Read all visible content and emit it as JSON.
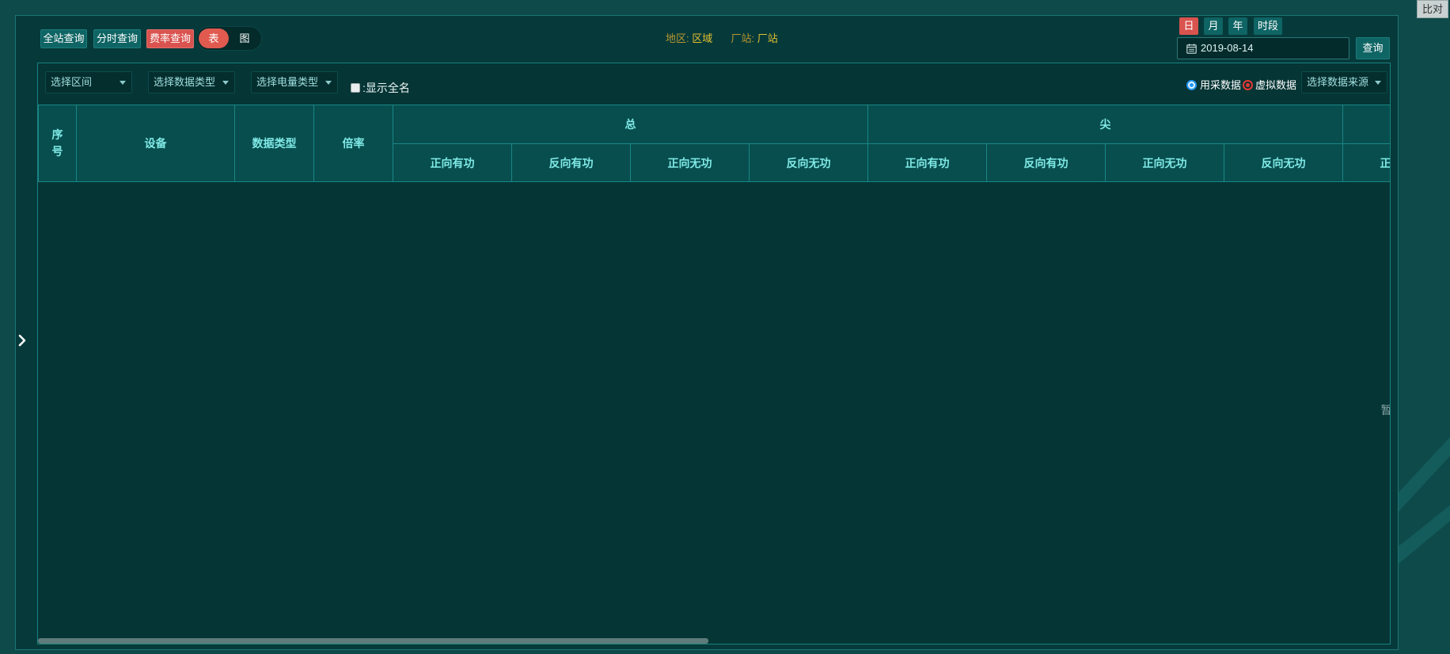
{
  "compare_button": {
    "label": "比对"
  },
  "toolbar": {
    "buttons": [
      {
        "label": "全站查询"
      },
      {
        "label": "分时查询"
      },
      {
        "label": "费率查询",
        "active": true
      }
    ],
    "view_toggle": {
      "options": [
        "表",
        "图"
      ],
      "selected": "表"
    }
  },
  "location": {
    "region_label": "地区:",
    "region_value": "区域",
    "station_label": "厂站:",
    "station_value": "厂站"
  },
  "period_tabs": {
    "options": [
      "日",
      "月",
      "年",
      "时段"
    ],
    "selected": "日"
  },
  "date_picker": {
    "value": "2019-08-14",
    "icon": "calendar-icon"
  },
  "query_button": {
    "label": "查询"
  },
  "filters": {
    "selects": [
      {
        "placeholder": "选择区间"
      },
      {
        "placeholder": "选择数据类型"
      },
      {
        "placeholder": "选择电量类型"
      }
    ],
    "show_full_name": {
      "label": ":显示全名",
      "checked": false
    }
  },
  "data_source": {
    "options": [
      {
        "label": "用采数据"
      },
      {
        "label": "虚拟数据"
      }
    ],
    "select_placeholder": "选择数据来源"
  },
  "table": {
    "fixed_columns": [
      "序号",
      "设备",
      "数据类型",
      "倍率"
    ],
    "groups": [
      "总",
      "尖",
      "",
      "",
      ""
    ],
    "sub_columns": [
      "正向有功",
      "反向有功",
      "正向无功",
      "反向无功"
    ],
    "rows": [],
    "empty_text": "暂无数据"
  },
  "sidebar_toggle": {
    "icon": "chevron-right-icon"
  },
  "colors": {
    "page_bg": "#0e4a4a",
    "panel_bg": "#063a3a",
    "content_bg": "#053535",
    "btn_teal": "#0f6464",
    "accent_red": "#d9534f",
    "header_text": "#7fe9e6",
    "label_gold": "#b8962e",
    "value_gold": "#e3bf30",
    "radio_blue": "#2196f3",
    "radio_red": "#e53935"
  }
}
